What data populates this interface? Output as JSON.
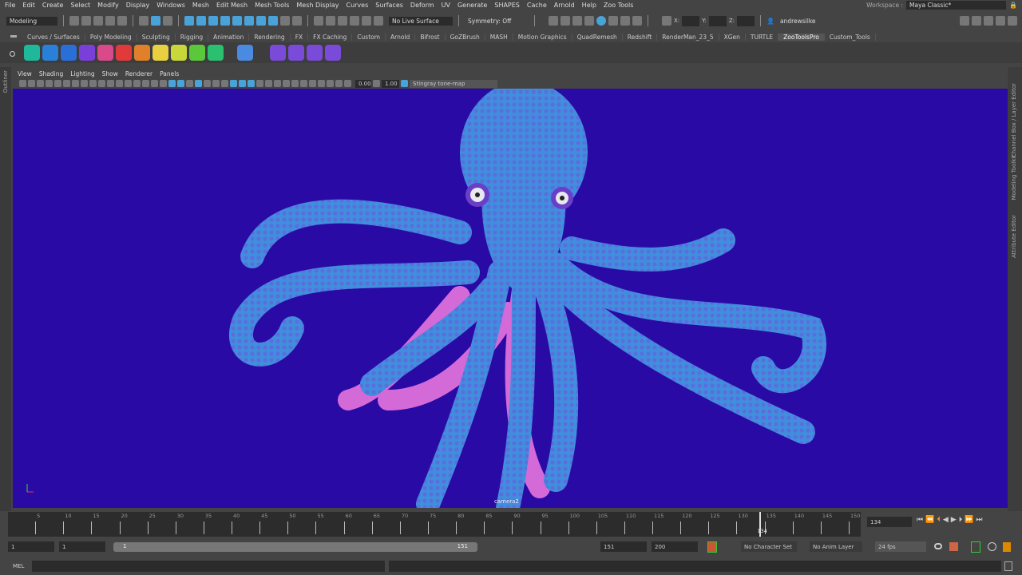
{
  "menu": [
    "File",
    "Edit",
    "Create",
    "Select",
    "Modify",
    "Display",
    "Windows",
    "Mesh",
    "Edit Mesh",
    "Mesh Tools",
    "Mesh Display",
    "Curves",
    "Surfaces",
    "Deform",
    "UV",
    "Generate",
    "SHAPES",
    "Cache",
    "Arnold",
    "Help",
    "Zoo Tools"
  ],
  "workspace": {
    "label": "Workspace :",
    "value": "Maya Classic*"
  },
  "status": {
    "mode": "Modeling",
    "live_surface": "No Live Surface",
    "symmetry": "Symmetry: Off",
    "x": "X:",
    "y": "Y:",
    "z": "Z:",
    "user": "andrewsilke"
  },
  "shelf_tabs": [
    "Curves / Surfaces",
    "Poly Modeling",
    "Sculpting",
    "Rigging",
    "Animation",
    "Rendering",
    "FX",
    "FX Caching",
    "Custom",
    "Arnold",
    "Bifrost",
    "GoZBrush",
    "MASH",
    "Motion Graphics",
    "QuadRemesh",
    "Redshift",
    "RenderMan_23_5",
    "XGen",
    "TURTLE",
    "ZooToolsPro",
    "Custom_Tools"
  ],
  "active_shelf": "ZooToolsPro",
  "shelf_icon_colors": [
    "#1fb89a",
    "#2a7fd8",
    "#2a6fd8",
    "#7a3fd8",
    "#d84a8a",
    "#e03a3a",
    "#e0802a",
    "#e8d040",
    "#c8d83a",
    "#5ac83a",
    "#2ac070",
    "#4a8ae0",
    "#7a4ad8",
    "#7a4ad8",
    "#7a4ad8",
    "#7a4ad8"
  ],
  "outliner_label": "Outliner",
  "panel_menu": [
    "View",
    "Shading",
    "Lighting",
    "Show",
    "Renderer",
    "Panels"
  ],
  "panel_toolbar": {
    "exposure": "0.00",
    "gamma": "1.00",
    "tone_map": "Stingray tone-map"
  },
  "viewport": {
    "camera": "camera2",
    "bg": "#2a0aa5"
  },
  "right_tabs": [
    "Channel Box / Layer Editor",
    "Modeling Toolkit",
    "Attribute Editor"
  ],
  "timeline": {
    "start": 1,
    "end": 151,
    "labels": [
      5,
      10,
      15,
      20,
      25,
      30,
      35,
      40,
      45,
      50,
      55,
      60,
      65,
      70,
      75,
      80,
      85,
      90,
      95,
      100,
      105,
      110,
      115,
      120,
      125,
      130,
      135,
      140,
      145,
      150
    ],
    "current": 134,
    "current_field": "134"
  },
  "range": {
    "start": "1",
    "playback_start": "1",
    "slider_start": "1",
    "slider_end": "151",
    "playback_end": "151",
    "end": "200",
    "char_set": "No Character Set",
    "anim_layer": "No Anim Layer",
    "fps": "24 fps"
  },
  "cmdline": {
    "label": "MEL"
  }
}
